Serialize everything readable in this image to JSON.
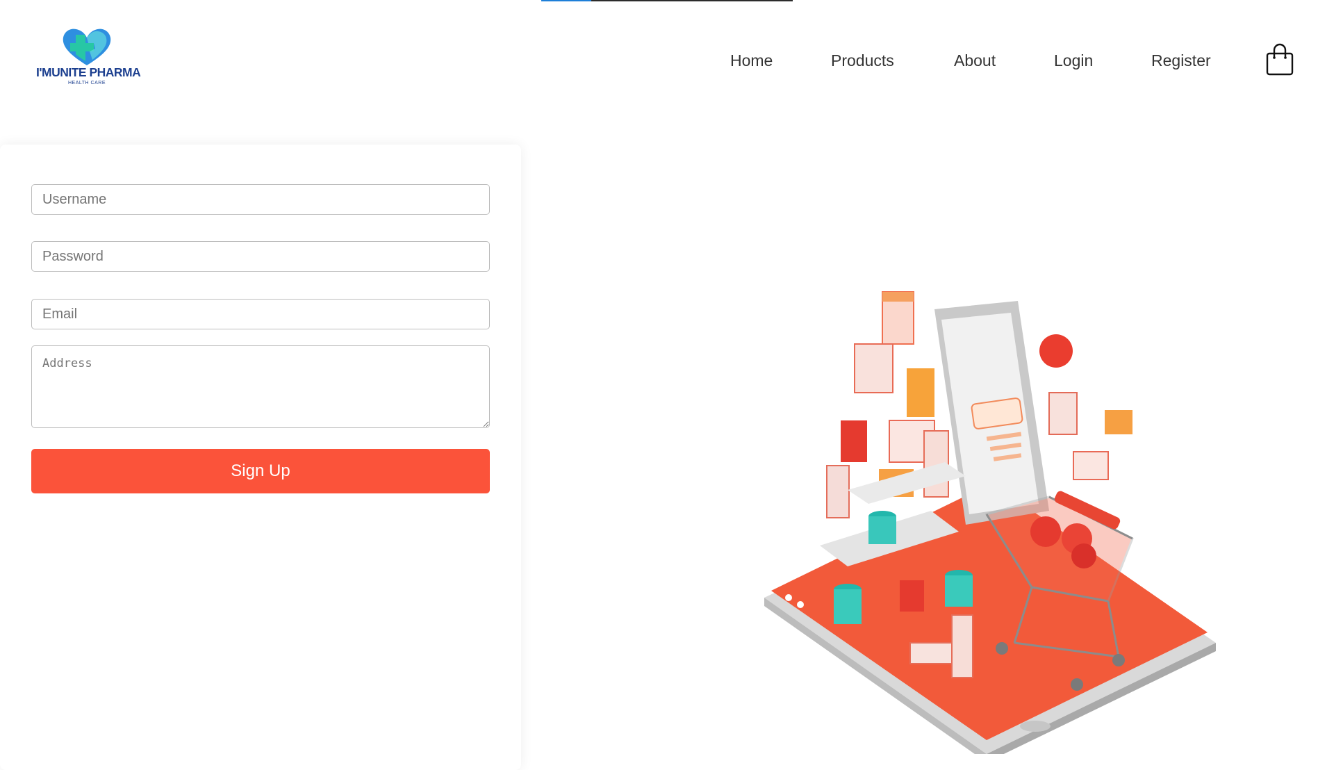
{
  "loading_bar": {
    "progress": 0.2,
    "fill_color": "#1e7fd8",
    "track_color": "#2b2b2b"
  },
  "brand": {
    "name": "I'MUNITE PHARMA",
    "tagline": "HEALTH CARE",
    "logo_icon": "heart-cross-icon",
    "colors": {
      "teal": "#27c7a5",
      "blue": "#2e8fe0",
      "navy": "#1c3f8f"
    }
  },
  "nav": {
    "items": [
      {
        "label": "Home"
      },
      {
        "label": "Products"
      },
      {
        "label": "About"
      },
      {
        "label": "Login"
      },
      {
        "label": "Register"
      }
    ],
    "cart_icon": "shopping-bag-icon"
  },
  "signup_form": {
    "username": {
      "placeholder": "Username",
      "value": ""
    },
    "password": {
      "placeholder": "Password",
      "value": ""
    },
    "email": {
      "placeholder": "Email",
      "value": ""
    },
    "address": {
      "placeholder": "Address",
      "value": ""
    },
    "submit_label": "Sign Up",
    "accent_color": "#fb533a"
  },
  "hero": {
    "illustration": "phone-shopping-cart-pharmacy-illustration"
  }
}
